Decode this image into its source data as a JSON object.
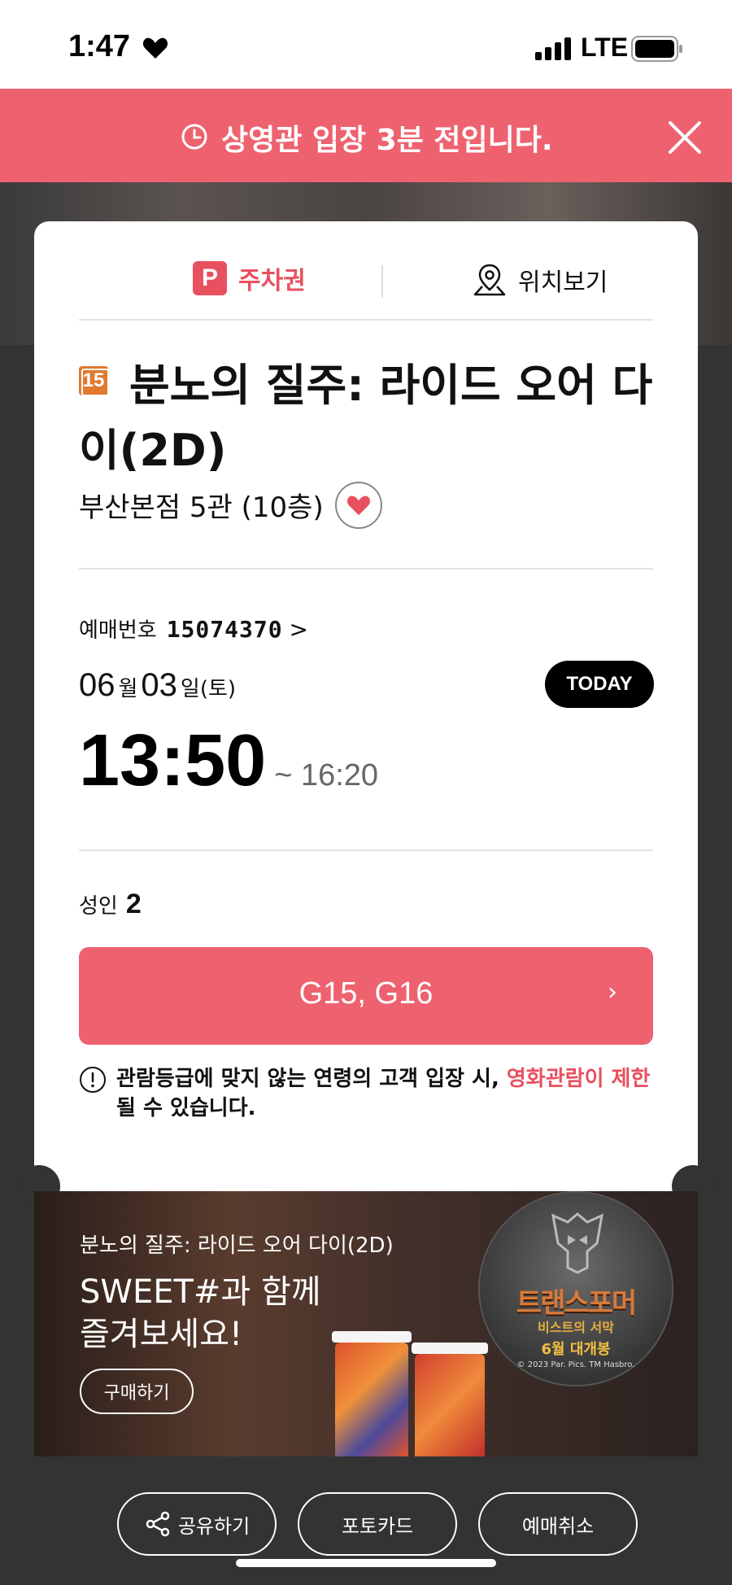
{
  "status_bar": {
    "time": "1:47",
    "network": "LTE"
  },
  "notice": {
    "message": "상영관 입장 3분 전입니다."
  },
  "ticket": {
    "parking_badge": "P",
    "parking_label": "주차권",
    "location_label": "위치보기",
    "rating": "15",
    "movie_title": "분노의 질주: 라이드 오어 다이(2D)",
    "theater": "부산본점 5관 (10층)",
    "reservation_label": "예매번호",
    "reservation_number": "15074370",
    "reservation_chevron": ">",
    "date": {
      "month": "06",
      "month_unit": "월",
      "day": "03",
      "day_unit": "일(토)"
    },
    "today_badge": "TODAY",
    "start_time": "13:50",
    "end_time": "~ 16:20",
    "audience_label": "성인",
    "audience_count": "2",
    "seats": "G15, G16",
    "seats_chevron": "›",
    "warning_text": "관람등급에 맞지 않는 연령의 고객 입장 시, ",
    "warning_highlight": "영화관람이 제한",
    "warning_tail": "될 수 있습니다."
  },
  "promo": {
    "movie": "분노의 질주: 라이드 오어 다이(2D)",
    "headline_line1": "SWEET#과 함께",
    "headline_line2": "즐겨보세요!",
    "buy_label": "구매하기",
    "poster_title": "트랜스포머",
    "poster_subtitle": "비스트의 서막",
    "poster_date": "6월 대개봉",
    "poster_copyright": "© 2023 Par. Pics. TM Hasbro."
  },
  "actions": {
    "share_label": "공유하기",
    "photocard_label": "포토카드",
    "cancel_label": "예매취소"
  },
  "colors": {
    "accent": "#ee6270",
    "rating": "#e07a30",
    "background": "#333333"
  }
}
